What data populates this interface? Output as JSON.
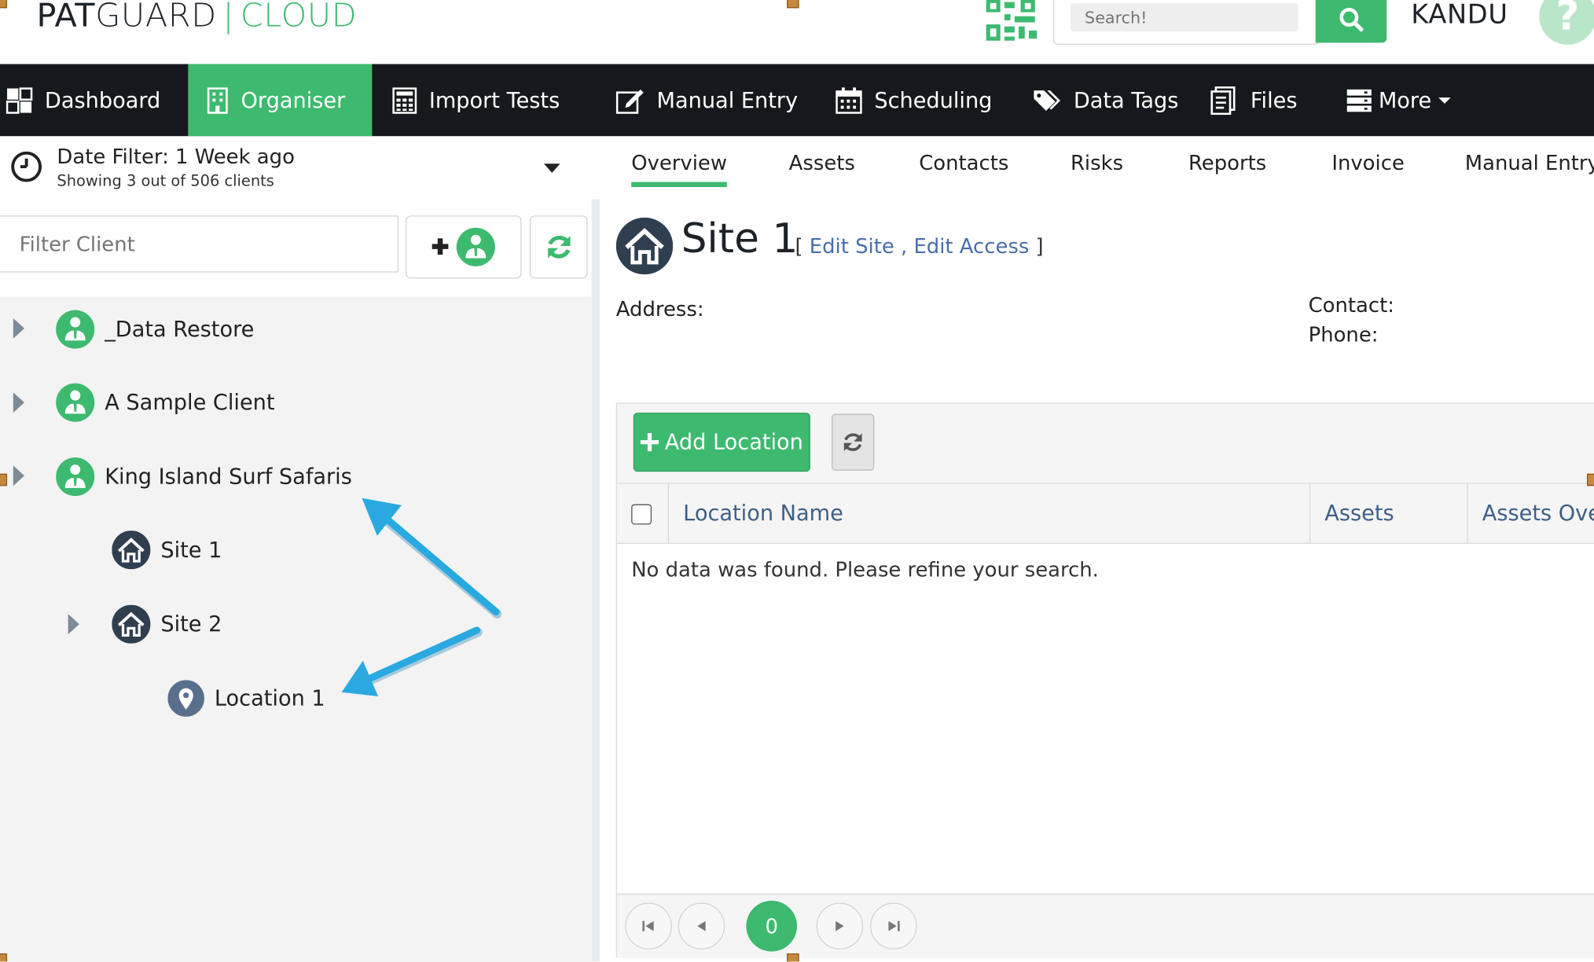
{
  "header": {
    "logo": {
      "pat": "PAT",
      "guard": "GUARD",
      "separator": "|",
      "cloud": "CLOUD"
    },
    "search": {
      "placeholder": "Search!"
    },
    "user_name": "KANDU",
    "help": "?"
  },
  "nav": [
    {
      "label": "Dashboard",
      "icon": "dashboard-icon"
    },
    {
      "label": "Organiser",
      "icon": "building-icon",
      "active": true
    },
    {
      "label": "Import Tests",
      "icon": "calculator-icon"
    },
    {
      "label": "Manual Entry",
      "icon": "edit-icon"
    },
    {
      "label": "Scheduling",
      "icon": "calendar-icon"
    },
    {
      "label": "Data Tags",
      "icon": "tags-icon"
    },
    {
      "label": "Files",
      "icon": "files-icon"
    },
    {
      "label": "More",
      "icon": "server-icon"
    }
  ],
  "date_filter": {
    "title": "Date Filter: 1 Week ago",
    "subtitle": "Showing 3 out of 506 clients"
  },
  "tabs": [
    "Overview",
    "Assets",
    "Contacts",
    "Risks",
    "Reports",
    "Invoice",
    "Manual Entry"
  ],
  "left": {
    "filter_placeholder": "Filter Client",
    "tree": [
      {
        "label": "_Data Restore",
        "type": "client"
      },
      {
        "label": "A Sample Client",
        "type": "client"
      },
      {
        "label": "King Island Surf Safaris",
        "type": "client"
      },
      {
        "label": "Site 1",
        "type": "site"
      },
      {
        "label": "Site 2",
        "type": "site"
      },
      {
        "label": "Location 1",
        "type": "location"
      }
    ]
  },
  "site": {
    "title": "Site 1",
    "links_open": "[",
    "edit_site": "Edit Site",
    "comma": ",",
    "edit_access": "Edit Access",
    "links_close": "]",
    "address_label": "Address",
    "contact_label": "Contact",
    "phone_label": "Phone"
  },
  "locations": {
    "add_label": "Add Location",
    "columns": [
      "Location Name",
      "Assets",
      "Assets Ove"
    ],
    "empty_message": "No data was found. Please refine your search.",
    "current_page": "0"
  },
  "colors": {
    "accent": "#3dba6f",
    "nav_bg": "#15191d",
    "link": "#4a6ea9",
    "annotation": "#29a9e0"
  }
}
